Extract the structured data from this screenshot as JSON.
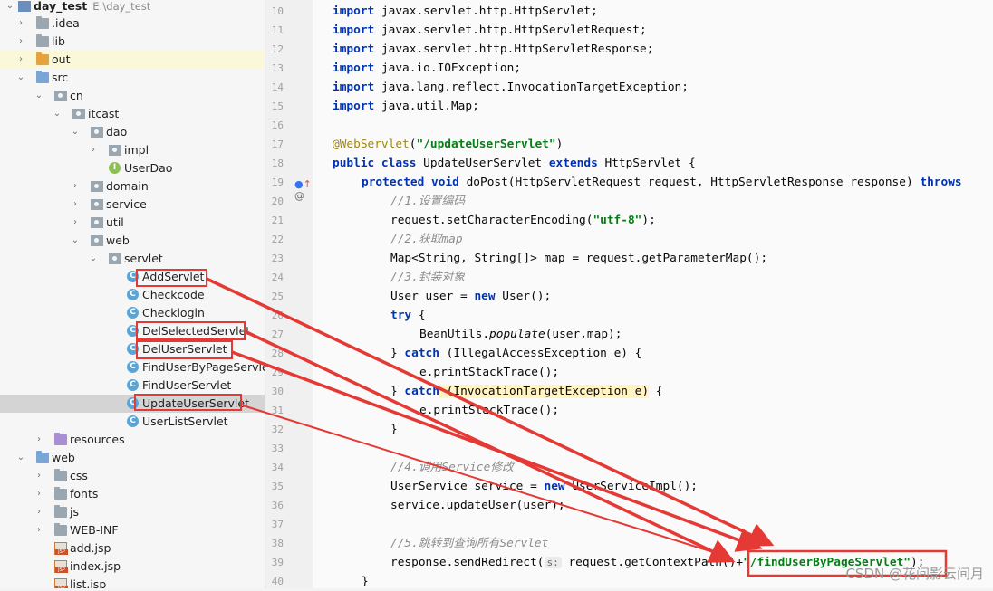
{
  "project_tree": {
    "root": {
      "name": "day_test",
      "path": "E:\\day_test"
    },
    "items": [
      {
        "label": ".idea"
      },
      {
        "label": "lib"
      },
      {
        "label": "out"
      },
      {
        "label": "src"
      },
      {
        "label": "cn"
      },
      {
        "label": "itcast"
      },
      {
        "label": "dao"
      },
      {
        "label": "impl"
      },
      {
        "label": "UserDao"
      },
      {
        "label": "domain"
      },
      {
        "label": "service"
      },
      {
        "label": "util"
      },
      {
        "label": "web"
      },
      {
        "label": "servlet"
      },
      {
        "label": "AddServlet"
      },
      {
        "label": "Checkcode"
      },
      {
        "label": "Checklogin"
      },
      {
        "label": "DelSelectedServlet"
      },
      {
        "label": "DelUserServlet"
      },
      {
        "label": "FindUserByPageServlet"
      },
      {
        "label": "FindUserServlet"
      },
      {
        "label": "UpdateUserServlet"
      },
      {
        "label": "UserListServlet"
      },
      {
        "label": "resources"
      },
      {
        "label": "web"
      },
      {
        "label": "css"
      },
      {
        "label": "fonts"
      },
      {
        "label": "js"
      },
      {
        "label": "WEB-INF"
      },
      {
        "label": "add.jsp"
      },
      {
        "label": "index.jsp"
      },
      {
        "label": "list.jsp"
      }
    ]
  },
  "editor": {
    "line_numbers": [
      "10",
      "11",
      "12",
      "13",
      "14",
      "15",
      "16",
      "17",
      "18",
      "19",
      "20",
      "21",
      "22",
      "23",
      "24",
      "25",
      "26",
      "27",
      "28",
      "29",
      "30",
      "31",
      "32",
      "33",
      "34",
      "35",
      "36",
      "37",
      "38",
      "39",
      "40"
    ],
    "code": {
      "l10_kw": "import",
      "l10_rest": " javax.servlet.http.HttpServlet;",
      "l11_kw": "import",
      "l11_rest": " javax.servlet.http.HttpServletRequest;",
      "l12_kw": "import",
      "l12_rest": " javax.servlet.http.HttpServletResponse;",
      "l13_kw": "import",
      "l13_rest": " java.io.IOException;",
      "l14_kw": "import",
      "l14_rest": " java.lang.reflect.InvocationTargetException;",
      "l15_kw": "import",
      "l15_rest": " java.util.Map;",
      "l17_ann": "@WebServlet",
      "l17_p1": "(",
      "l17_str": "\"/updateUserServlet\"",
      "l17_p2": ")",
      "l18_kw1": "public class",
      "l18_name": " UpdateUserServlet ",
      "l18_kw2": "extends",
      "l18_rest": " HttpServlet {",
      "l19_kw1": "protected void",
      "l19_rest": " doPost(HttpServletRequest request, HttpServletResponse response) ",
      "l19_kw2": "throws",
      "l20_cmt": "//1.设置编码",
      "l21_p1": "request.setCharacterEncoding(",
      "l21_str": "\"utf-8\"",
      "l21_p2": ");",
      "l22_cmt": "//2.获取map",
      "l23": "Map<String, String[]> map = request.getParameterMap();",
      "l24_cmt": "//3.封装对象",
      "l25_p1": "User user = ",
      "l25_kw": "new",
      "l25_p2": " User();",
      "l26_kw": "try",
      "l26_p": " {",
      "l27_p1": "BeanUtils.",
      "l27_it": "populate",
      "l27_p2": "(user,map);",
      "l28_p1": "} ",
      "l28_kw": "catch",
      "l28_p2": " (IllegalAccessException e) {",
      "l29": "e.printStackTrace();",
      "l30_p1": "} ",
      "l30_kw": "catch",
      "l30_p2": " (InvocationTargetException e)",
      "l30_p3": " {",
      "l31": "e.printStackTrace();",
      "l32": "}",
      "l34_cmt": "//4.调用Service修改",
      "l35_p1": "UserService service = ",
      "l35_kw": "new",
      "l35_p2": " UserServiceImpl();",
      "l36": "service.updateUser(user);",
      "l38_cmt": "//5.跳转到查询所有Servlet",
      "l39_p1": "response.sendRedirect(",
      "l39_hint": "s:",
      "l39_p2": " request.getContextPath()+",
      "l39_str": "\"/findUserByPageServlet\"",
      "l39_p3": ");",
      "l40": "}"
    }
  },
  "watermark": "CSDN @花间影云间月",
  "colors": {
    "highlight_box": "#e53935",
    "keyword": "#0033b3",
    "string": "#067d17",
    "annotation": "#9e880d",
    "comment": "#8c8c8c"
  }
}
